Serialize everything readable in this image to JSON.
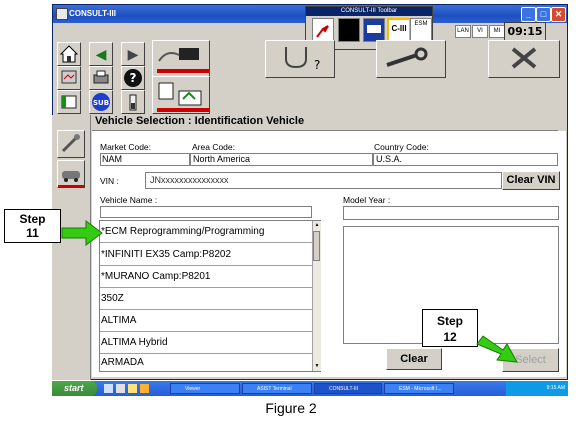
{
  "window": {
    "title": "CONSULT-III",
    "clock": "09:15",
    "min": "_",
    "max": "□",
    "close": "✕"
  },
  "toolbar_float": {
    "title": "CONSULT-III Toolbar",
    "buttons": [
      "",
      "",
      "C-III",
      "ESM"
    ]
  },
  "status_icons": [
    "LAN",
    "VI",
    "MI"
  ],
  "nav": {
    "sub_label": "SUB"
  },
  "heading": "Vehicle Selection : Identification Vehicle",
  "fields": {
    "market_code_label": "Market Code:",
    "market_code_value": "NAM",
    "area_code_label": "Area Code:",
    "area_code_value": "North America",
    "country_code_label": "Country Code:",
    "country_code_value": "U.S.A.",
    "vin_label": "VIN :",
    "vin_value": "JNxxxxxxxxxxxxxxx",
    "vehicle_name_label": "Vehicle Name :",
    "model_year_label": "Model Year :"
  },
  "vehicles": [
    "*ECM Reprogramming/Programming",
    "*INFINITI EX35 Camp:P8202",
    "*MURANO Camp:P8201",
    "350Z",
    "ALTIMA",
    "ALTIMA Hybrid",
    "ARMADA"
  ],
  "buttons": {
    "clear_vin": "Clear VIN",
    "clear": "Clear",
    "select": "Select"
  },
  "annotations": {
    "step11": "Step\n11",
    "step12": "Step\n12"
  },
  "taskbar": {
    "start": "start",
    "tasks": [
      "Viewer",
      "ASIST Terminal",
      "CONSULT-III",
      "ESM - Microsoft I..."
    ],
    "tray_time": "9:15 AM"
  },
  "caption": "Figure 2",
  "colors": {
    "arrow_green": "#33cc11",
    "accent_red": "#cc0000",
    "title_blue": "#1d4fbf"
  }
}
